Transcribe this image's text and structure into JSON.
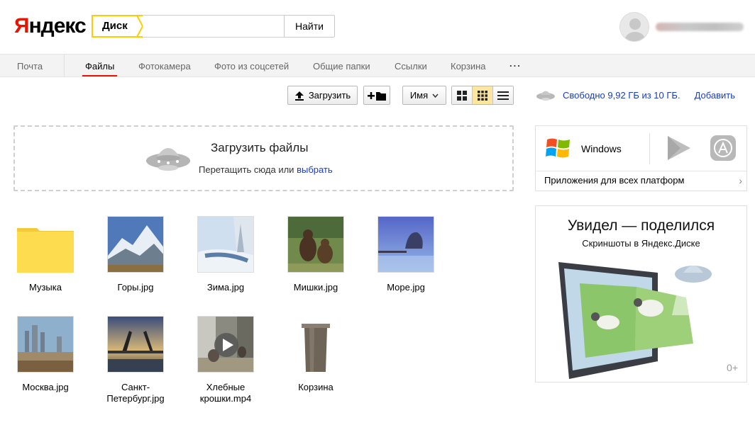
{
  "header": {
    "logo_ya": "Я",
    "logo_rest": "ндекс",
    "search_tag": "Диск",
    "search_placeholder": "",
    "find_label": "Найти"
  },
  "nav": {
    "items": [
      {
        "label": "Почта"
      },
      {
        "label": "Файлы"
      },
      {
        "label": "Фотокамера"
      },
      {
        "label": "Фото из соцсетей"
      },
      {
        "label": "Общие папки"
      },
      {
        "label": "Ссылки"
      },
      {
        "label": "Корзина"
      },
      {
        "label": "..."
      }
    ],
    "active": "Файлы"
  },
  "toolbar": {
    "upload_label": "Загрузить",
    "sort_label": "Имя"
  },
  "space": {
    "free_text": "Свободно 9,92 ГБ из 10 ГБ.",
    "add_label": "Добавить"
  },
  "dropzone": {
    "title": "Загрузить файлы",
    "sub_text": "Перетащить сюда или",
    "choose_link": "выбрать"
  },
  "files": [
    {
      "name": "Музыка",
      "type": "folder"
    },
    {
      "name": "Горы.jpg",
      "type": "image"
    },
    {
      "name": "Зима.jpg",
      "type": "image"
    },
    {
      "name": "Мишки.jpg",
      "type": "image"
    },
    {
      "name": "Море.jpg",
      "type": "image"
    },
    {
      "name": "Москва.jpg",
      "type": "image"
    },
    {
      "name": "Санкт-Петербург.jpg",
      "type": "image"
    },
    {
      "name": "Хлебные крошки.mp4",
      "type": "video"
    },
    {
      "name": "Корзина",
      "type": "trash"
    }
  ],
  "apps": {
    "windows_label": "Windows",
    "all_platforms": "Приложения для всех платформ"
  },
  "promo": {
    "title": "Увидел — поделился",
    "subtitle": "Скриншоты в Яндекс.Диске",
    "age": "0+"
  },
  "colors": {
    "brand_red": "#e61400",
    "tag_yellow": "#ffcc00",
    "link_blue": "#1a3dc1",
    "folder_yellow": "#fddc4f"
  }
}
